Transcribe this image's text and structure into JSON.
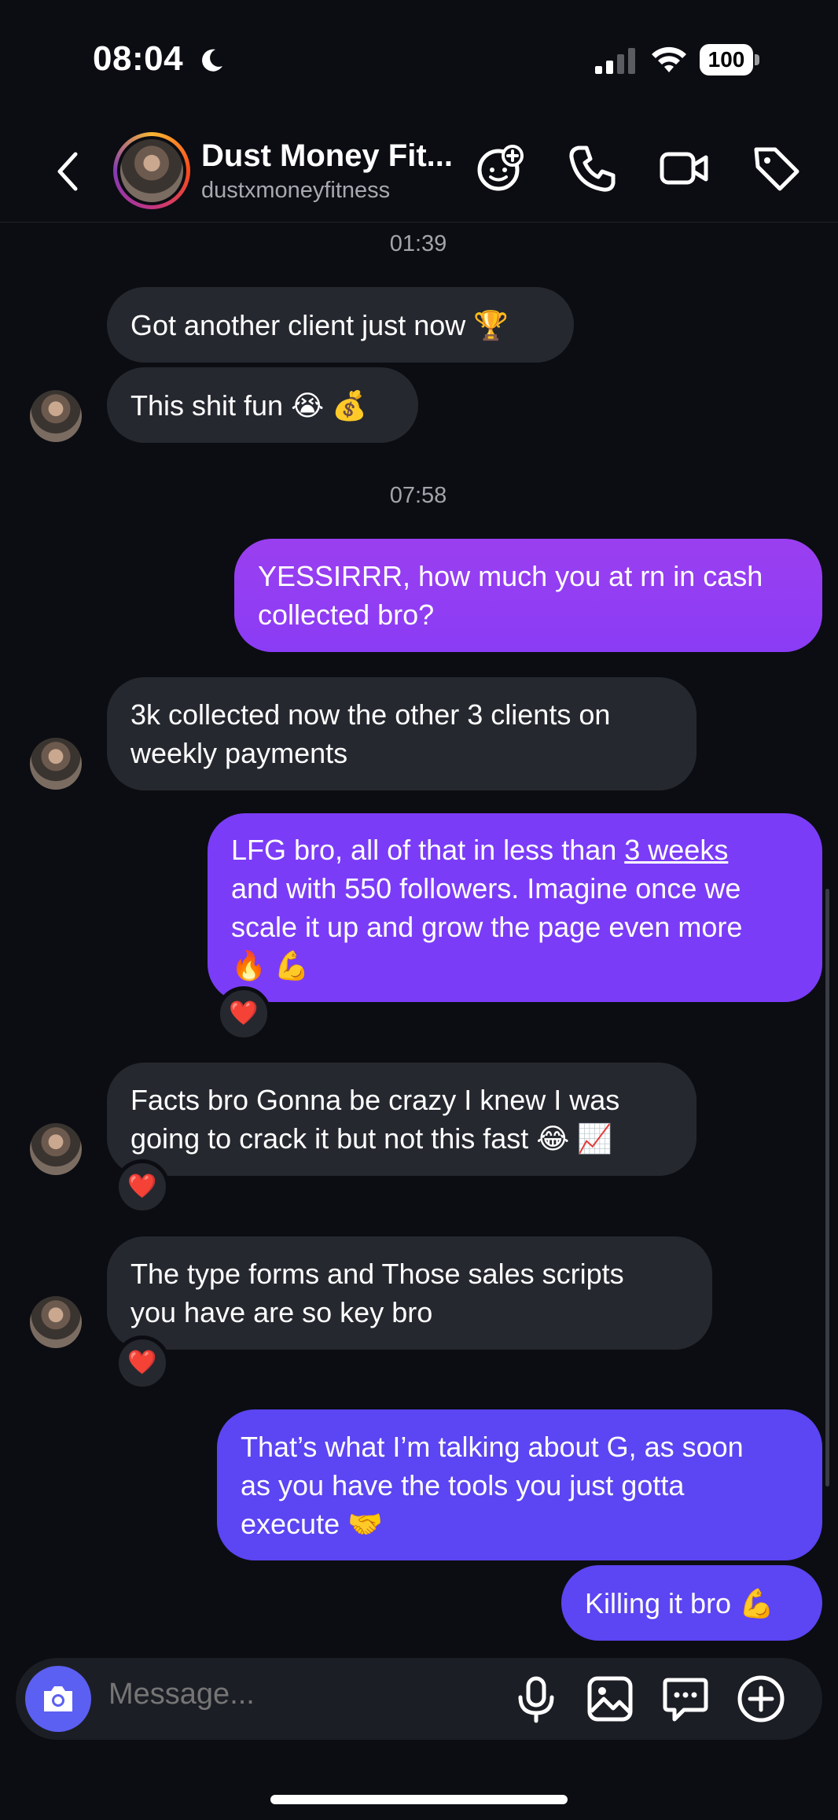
{
  "status_bar": {
    "time": "08:04",
    "battery": "100"
  },
  "header": {
    "name": "Dust Money Fit...",
    "username": "dustxmoneyfitness"
  },
  "timestamps": [
    "01:39",
    "07:58"
  ],
  "messages": [
    {
      "text": "Got another client just now 🏆"
    },
    {
      "text": "This shit fun 😭 💰"
    },
    {
      "line1": "YESSIRRR, how much you at rn in cash",
      "line2": "collected bro?"
    },
    {
      "line1": "3k collected now the other 3 clients on",
      "line2": "weekly payments"
    },
    {
      "line1_pre": "LFG bro, all of that in less than ",
      "line1_link": "3 weeks",
      "line2": "and with 550 followers. Imagine once we",
      "line3": "scale it up and grow the page even more",
      "line4": "🔥 💪",
      "reaction": "❤️"
    },
    {
      "line1": "Facts bro Gonna be crazy I knew I was",
      "line2": "going to crack it but not this fast 😂 📈",
      "reaction": "❤️"
    },
    {
      "line1": "The type forms and Those sales scripts",
      "line2": "you have are so key bro",
      "reaction": "❤️"
    },
    {
      "line1": "That’s what I’m talking about G, as soon",
      "line2": "as you have the tools you just gotta",
      "line3": "execute 🤝"
    },
    {
      "text": "Killing it bro 💪"
    }
  ],
  "composer": {
    "placeholder": "Message..."
  },
  "icons": [
    "back-icon",
    "sticker-icon",
    "phone-icon",
    "video-icon",
    "tag-icon",
    "camera-icon",
    "microphone-icon",
    "gallery-icon",
    "chat-bubble-icon",
    "plus-icon"
  ]
}
